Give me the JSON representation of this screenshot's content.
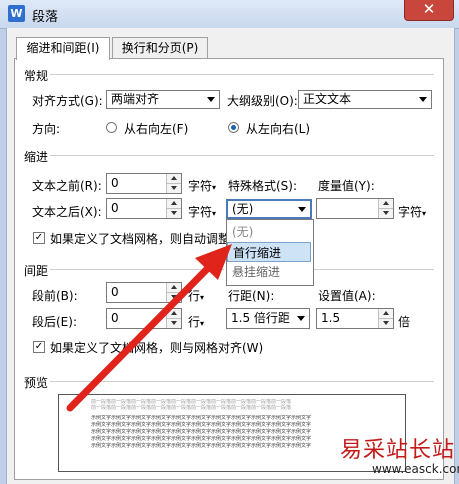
{
  "window": {
    "title": "段落",
    "app_icon_letter": "W",
    "close_glyph": "✕"
  },
  "tabs": [
    {
      "label": "缩进和间距(I)",
      "active": true
    },
    {
      "label": "换行和分页(P)",
      "active": false
    }
  ],
  "general": {
    "section_title": "常规",
    "alignment_label": "对齐方式(G):",
    "alignment_value": "两端对齐",
    "outline_label": "大纲级别(O):",
    "outline_value": "正文文本",
    "direction_label": "方向:",
    "direction_rtl": "从右向左(F)",
    "direction_ltr": "从左向右(L)",
    "direction_selected": "ltr"
  },
  "indent": {
    "section_title": "缩进",
    "before_label": "文本之前(R):",
    "before_value": "0",
    "before_unit": "字符",
    "after_label": "文本之后(X):",
    "after_value": "0",
    "after_unit": "字符",
    "special_label": "特殊格式(S):",
    "special_value": "(无)",
    "measure_label": "度量值(Y):",
    "measure_value": "",
    "measure_unit": "字符",
    "grid_check_label": "如果定义了文档网格，则自动调整",
    "grid_checked": true,
    "dropdown_options": [
      "(无)",
      "首行缩进",
      "悬挂缩进"
    ],
    "dropdown_highlighted": "首行缩进"
  },
  "spacing": {
    "section_title": "间距",
    "before_label": "段前(B):",
    "before_value": "0",
    "before_unit": "行",
    "after_label": "段后(E):",
    "after_value": "0",
    "after_unit": "行",
    "line_label": "行距(N):",
    "line_value": "1.5 倍行距",
    "setting_label": "设置值(A):",
    "setting_value": "1.5",
    "setting_unit": "倍",
    "grid_check_label": "如果定义了文档网格，则与网格对齐(W)",
    "grid_checked": true
  },
  "preview": {
    "section_title": "预览",
    "line_text_prev": "前一段落前一段落前一段落前一段落前一段落前一段落前一段落前一段落前一段落前一段落",
    "line_text_cur": "示例文字示例文字示例文字示例文字示例文字示例文字示例文字示例文字示例文字示例文字示例文字"
  },
  "watermark": {
    "text": "易采站长站",
    "url": "www.easck.com"
  },
  "colors": {
    "arrow": "#e0241b",
    "selection": "#cfe3f7",
    "accent": "#1a5fb4"
  }
}
